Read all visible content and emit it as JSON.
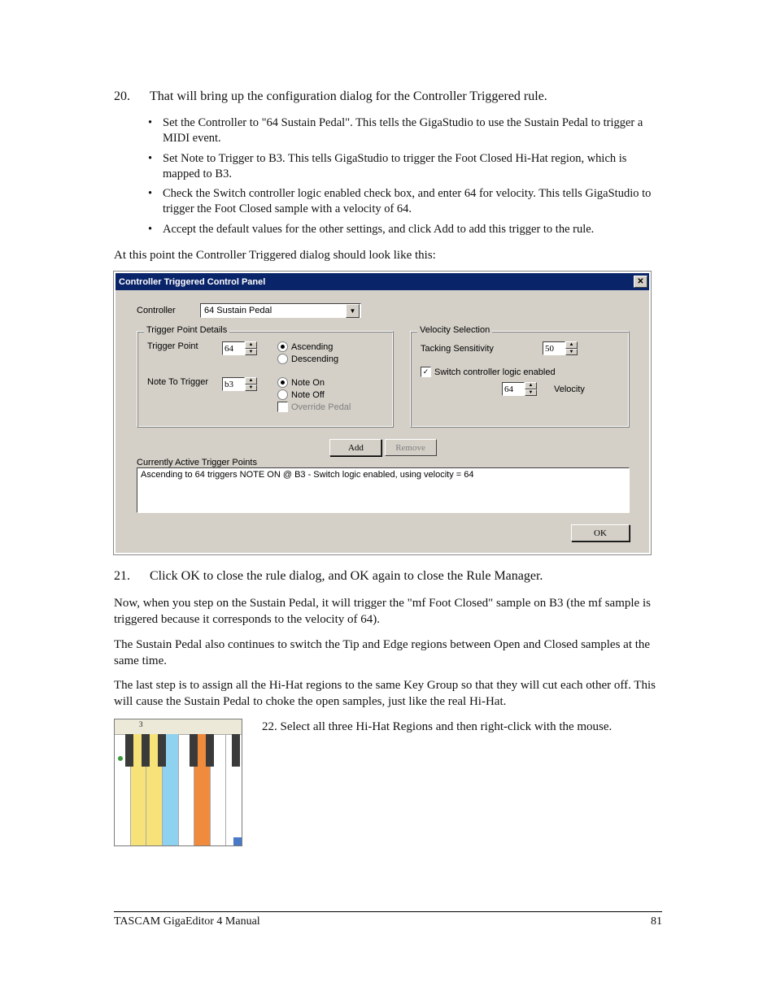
{
  "step20": {
    "num": "20.",
    "text": "That will bring up the configuration dialog for the Controller Triggered rule.",
    "bullets": [
      "Set the Controller to \"64 Sustain Pedal\".  This tells the GigaStudio to use the Sustain Pedal to trigger a MIDI event.",
      "Set Note to Trigger to B3.  This tells GigaStudio to trigger the Foot Closed Hi-Hat region, which is mapped to B3.",
      "Check the Switch controller logic enabled check box, and enter 64 for velocity.  This tells GigaStudio to trigger the Foot Closed sample with a velocity of 64.",
      "Accept the default values for the other settings, and click Add to add this trigger to the rule."
    ]
  },
  "lead_in": "At this point the Controller Triggered dialog should look like this:",
  "dialog": {
    "title": "Controller Triggered Control Panel",
    "controller_label": "Controller",
    "controller_value": "64 Sustain Pedal",
    "tp_group": "Trigger Point Details",
    "trigger_point_label": "Trigger Point",
    "trigger_point_value": "64",
    "ascending": "Ascending",
    "descending": "Descending",
    "note_to_trigger_label": "Note To Trigger",
    "note_to_trigger_value": "b3",
    "note_on": "Note On",
    "note_off": "Note Off",
    "override_pedal": "Override Pedal",
    "vs_group": "Velocity Selection",
    "tacking_label": "Tacking Sensitivity",
    "tacking_value": "50",
    "switch_logic": "Switch controller logic enabled",
    "velocity_value": "64",
    "velocity_label": "Velocity",
    "add": "Add",
    "remove": "Remove",
    "active_label": "Currently Active Trigger Points",
    "active_item": "Ascending  to 64 triggers NOTE ON @ B3 - Switch logic enabled, using velocity = 64",
    "ok": "OK"
  },
  "step21": {
    "num": "21.",
    "text": "Click OK to close the rule dialog, and OK again to close the Rule Manager."
  },
  "para_now": "Now, when you step on the Sustain Pedal, it will trigger the \"mf Foot Closed\" sample on B3 (the mf sample is triggered because it corresponds to the velocity of 64).",
  "para_sustain": "The Sustain Pedal also continues to switch the Tip and Edge regions between Open and Closed samples at the same time.",
  "para_last": "The last step is to assign all the Hi-Hat regions to the same Key Group so that they will cut each other off. This will cause the Sustain Pedal to choke the open samples, just like the real Hi-Hat.",
  "step22": "22. Select all three Hi-Hat Regions and then right-click with the mouse.",
  "kbd_mark": "3",
  "footer": {
    "left": "TASCAM GigaEditor 4 Manual",
    "right": "81"
  }
}
